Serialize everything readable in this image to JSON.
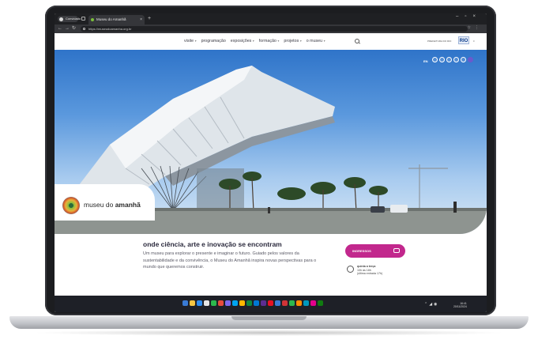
{
  "browser": {
    "profile_label": "Convidado",
    "tab_title": "Museu do Amanhã",
    "url": "https://museudoamanha.org.br"
  },
  "site": {
    "nav": [
      "visite",
      "programação",
      "exposições",
      "formação",
      "projetos",
      "o museu"
    ],
    "prefeitura_label": "PREFEITURA DO RIO",
    "rio_logo": "RIO",
    "lang_label": "EN",
    "brand_prefix": "museu do ",
    "brand_name": "amanhã",
    "headline": "onde ciência, arte e inovação se encontram",
    "intro": "Um museu para explorar o presente e imaginar o futuro. Guiado pelos valores da sustentabilidade e da convivência, o Museu do Amanhã inspira novas perspectivas para o mundo que queremos construir.",
    "ticket_label": "INGRESSOS",
    "hours_title": "quinta a terça",
    "hours_time": "10h às 18h",
    "hours_note": "(última entrada 17h)"
  },
  "taskbar": {
    "time": "16:41",
    "date": "20/11/2024",
    "icon_colors": [
      "#3a7bd5",
      "#f4c542",
      "#2d8cf0",
      "#e6e6e6",
      "#2db84d",
      "#e84c3d",
      "#7b68ee",
      "#00a4ef",
      "#ffb900",
      "#10893e",
      "#0078d4",
      "#5c2d91",
      "#e81123",
      "#3a7bd5",
      "#d13438",
      "#2db84d",
      "#ff8c00",
      "#0099bc",
      "#e3008c",
      "#107c10"
    ]
  },
  "colors": {
    "accent": "#c2288d",
    "heading": "#2b2a3d"
  }
}
